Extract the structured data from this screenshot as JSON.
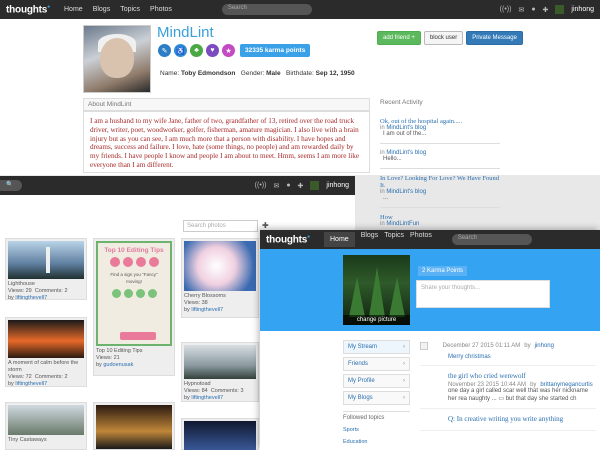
{
  "colors": {
    "brand": "#39a0e0",
    "topbar": "#2b2b2b",
    "banner": "#33a3f2",
    "about_text": "#a82a2a",
    "link": "#2a6fb0"
  },
  "common": {
    "logo": "thoughts",
    "nav": [
      "Home",
      "Blogs",
      "Topics",
      "Photos"
    ],
    "search_placeholder": "Search",
    "user": "jinhong",
    "icons": [
      "wifi-icon",
      "mail-icon",
      "chat-icon",
      "settings-icon"
    ]
  },
  "profile": {
    "username": "MindLint",
    "karma": "32335 karma points",
    "name_label": "Name:",
    "name": "Toby Edmondson",
    "gender_label": "Gender:",
    "gender": "Male",
    "birthdate_label": "Birthdate:",
    "birthdate": "Sep 12, 1950",
    "actions": {
      "add_friend": "add friend +",
      "block": "block user",
      "message": "Private Message"
    },
    "about_title": "About MindLint",
    "about_text": "I am a husband to my wife Jane, father of two, grandfather of 13, retired over the road truck driver, writer, poet, woodworker, golfer, fisherman, amature magician.  I also live with a brain injury but as you can see, I am much more that a person with disability. I have hopes and dreams, success and failure. I love, hate (some things, no people) and am rewarded daily by my friends.  I have people I know and people I am about to meet.  Hmm, seems I am more like everyone than I am different.",
    "recent_title": "Recent Activity",
    "recent": [
      {
        "title": "Ok, out of the hospital again.....",
        "in": "in",
        "blog": "MindLint's blog",
        "excerpt": "I am out of the..."
      },
      {
        "title": "",
        "in": "in",
        "blog": "MindLint's blog",
        "excerpt": "Hello..."
      },
      {
        "title": "In Love? Looking For Love? We Have Found It.",
        "in": "in",
        "blog": "MindLint's blog",
        "excerpt": "..."
      },
      {
        "title": "How",
        "in": "in",
        "blog": "MindLintFun",
        "excerpt": ""
      }
    ]
  },
  "photos": {
    "search_placeholder": "Search photos",
    "items": [
      {
        "caption": "Lighthouse",
        "views": "Views: 29",
        "comments": "Comments: 2",
        "by": "by",
        "author": "liftingthevell7"
      },
      {
        "caption": "A moment of calm before the storm",
        "views": "Views: 72",
        "comments": "Comments: 2",
        "by": "by",
        "author": "liftingthevell7"
      },
      {
        "caption": "Tiny Castaways",
        "views": "",
        "comments": "",
        "by": "",
        "author": ""
      },
      {
        "caption": "Top 10 Editing Tips",
        "views": "Views: 21",
        "comments": "",
        "by": "by",
        "author": "gudoenusak"
      },
      {
        "caption": "Cherry Blossoms",
        "views": "Views: 38",
        "comments": "",
        "by": "by",
        "author": "liftingthevell7"
      },
      {
        "caption": "Hypnotoad",
        "views": "Views: 84",
        "comments": "Comments: 3",
        "by": "by",
        "author": "liftingthevell7"
      }
    ],
    "poster": {
      "title": "Top 10 Editing Tips",
      "subtitle": "Find a sign you \"Fancy\" moving!"
    }
  },
  "feed": {
    "karma": "2 Karma Points",
    "share_placeholder": "Share your thoughts...",
    "change_picture": "change picture",
    "side": [
      "My Stream",
      "Friends",
      "My Profile",
      "My Blogs"
    ],
    "followed_label": "Followed topics",
    "topics": [
      "Sports",
      "Education"
    ],
    "posts": [
      {
        "date": "December 27 2015 01:11 AM",
        "by": "by",
        "author": "jinhong",
        "title": "",
        "body": "Merry christmas"
      },
      {
        "date": "November 23 2015 10:44 AM",
        "by": "by",
        "author": "brittanymegancurtis",
        "title": "the girl who cried werewolf",
        "body": "one day a girl called scar well that was her nickname her rea naughty ...",
        "more": "but that day she started ch"
      },
      {
        "date": "",
        "by": "",
        "author": "",
        "title": "Q: In creative writing you write anything",
        "body": ""
      }
    ]
  }
}
